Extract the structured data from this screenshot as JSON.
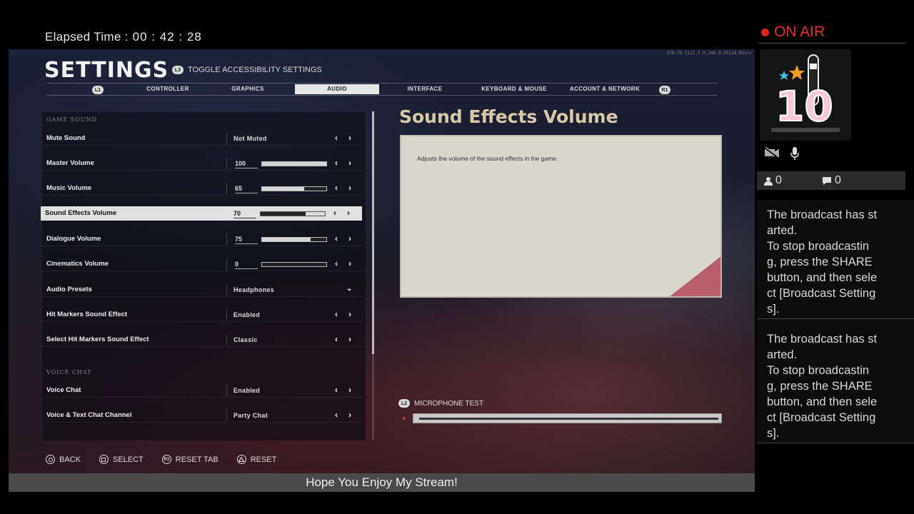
{
  "overlay": {
    "elapsed_label": "Elapsed Time :",
    "elapsed_value": "00 : 42 : 28",
    "ticker": "Hope You Enjoy My Stream!"
  },
  "game": {
    "version": "376.76 [11].7.0.248.9.31218.Min+L",
    "title": "SETTINGS",
    "accessibility_button": "L3",
    "accessibility_label": "TOGGLE ACCESSIBILITY SETTINGS",
    "left_bumper": "L1",
    "right_bumper": "R1",
    "tabs": [
      {
        "label": "CONTROLLER"
      },
      {
        "label": "GRAPHICS"
      },
      {
        "label": "AUDIO",
        "active": true
      },
      {
        "label": "INTERFACE"
      },
      {
        "label": "KEYBOARD & MOUSE"
      },
      {
        "label": "ACCOUNT & NETWORK"
      }
    ],
    "sections": {
      "game_sound": "GAME SOUND",
      "voice_chat": "VOICE CHAT"
    },
    "rows": [
      {
        "label": "Mute Sound",
        "value": "Not Muted"
      },
      {
        "label": "Master Volume",
        "number": "100",
        "level": 1.0
      },
      {
        "label": "Music Volume",
        "number": "65",
        "level": 0.65
      },
      {
        "label": "Sound Effects Volume",
        "number": "70",
        "level": 0.7,
        "selected": true
      },
      {
        "label": "Dialogue Volume",
        "number": "75",
        "level": 0.75
      },
      {
        "label": "Cinematics Volume",
        "number": "0",
        "level": 0.0
      },
      {
        "label": "Audio Presets",
        "value": "Headphones",
        "dropdown": true
      },
      {
        "label": "Hit Markers Sound Effect",
        "value": "Enabled"
      },
      {
        "label": "Select Hit Markers Sound Effect",
        "value": "Classic"
      },
      {
        "label": "Voice Chat",
        "value": "Enabled"
      },
      {
        "label": "Voice & Text Chat Channel",
        "value": "Party Chat"
      }
    ],
    "description": {
      "title": "Sound Effects Volume",
      "text": "Adjusts the volume of the sound effects in the game."
    },
    "mic_test": {
      "button": "L2",
      "label": "MICROPHONE TEST"
    },
    "hints": [
      {
        "button": "",
        "label": "BACK"
      },
      {
        "button": "",
        "label": "SELECT"
      },
      {
        "button": "R3",
        "label": "RESET TAB"
      },
      {
        "button": "",
        "label": "RESET"
      }
    ]
  },
  "broadcast": {
    "on_air": "ON AIR",
    "viewers": "0",
    "comments": "0",
    "messages": [
      "The broadcast has started.\nTo stop broadcasting, press the SHARE button, and then select [Broadcast Settings].",
      "The broadcast has started.\nTo stop broadcasting, press the SHARE button, and then select [Broadcast Settings]."
    ],
    "colors": {
      "accent": "#dd3333"
    }
  }
}
